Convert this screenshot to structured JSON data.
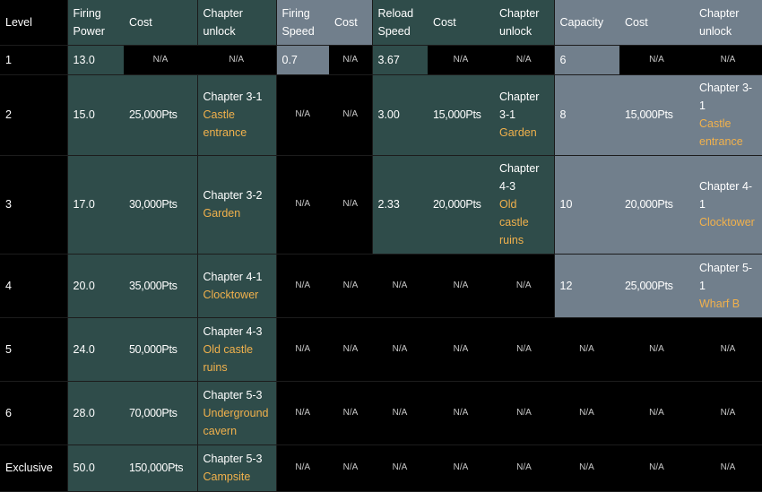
{
  "headers": {
    "level": "Level",
    "firing_power": "Firing Power",
    "cost": "Cost",
    "chapter_unlock": "Chapter unlock",
    "firing_speed": "Firing Speed",
    "reload_speed": "Reload Speed",
    "capacity": "Capacity"
  },
  "na": "N/A",
  "rows": [
    {
      "level": "1",
      "firing_power": "13.0",
      "firing_speed": "0.7",
      "reload_speed": "3.67",
      "capacity": "6"
    },
    {
      "level": "2",
      "firing_power": "15.0",
      "power_cost": "25,000Pts",
      "power_chapter": "Chapter 3-1",
      "power_chapter_loc": "Castle entrance",
      "reload_speed": "3.00",
      "reload_cost": "15,000Pts",
      "reload_chapter": "Chapter 3-1",
      "reload_chapter_loc": "Garden",
      "capacity": "8",
      "capacity_cost": "15,000Pts",
      "capacity_chapter": "Chapter 3-1",
      "capacity_chapter_loc": "Castle entrance"
    },
    {
      "level": "3",
      "firing_power": "17.0",
      "power_cost": "30,000Pts",
      "power_chapter": "Chapter 3-2",
      "power_chapter_loc": "Garden",
      "reload_speed": "2.33",
      "reload_cost": "20,000Pts",
      "reload_chapter": "Chapter 4-3",
      "reload_chapter_loc": "Old castle ruins",
      "capacity": "10",
      "capacity_cost": "20,000Pts",
      "capacity_chapter": "Chapter 4-1",
      "capacity_chapter_loc": "Clocktower"
    },
    {
      "level": "4",
      "firing_power": "20.0",
      "power_cost": "35,000Pts",
      "power_chapter": "Chapter 4-1",
      "power_chapter_loc": "Clocktower",
      "capacity": "12",
      "capacity_cost": "25,000Pts",
      "capacity_chapter": "Chapter 5-1",
      "capacity_chapter_loc": "Wharf B"
    },
    {
      "level": "5",
      "firing_power": "24.0",
      "power_cost": "50,000Pts",
      "power_chapter": "Chapter 4-3",
      "power_chapter_loc": "Old castle ruins"
    },
    {
      "level": "6",
      "firing_power": "28.0",
      "power_cost": "70,000Pts",
      "power_chapter": "Chapter 5-3",
      "power_chapter_loc": "Underground cavern"
    },
    {
      "level": "Exclusive",
      "firing_power": "50.0",
      "power_cost": "150,000Pts",
      "power_chapter": "Chapter 5-3",
      "power_chapter_loc": "Campsite"
    }
  ]
}
